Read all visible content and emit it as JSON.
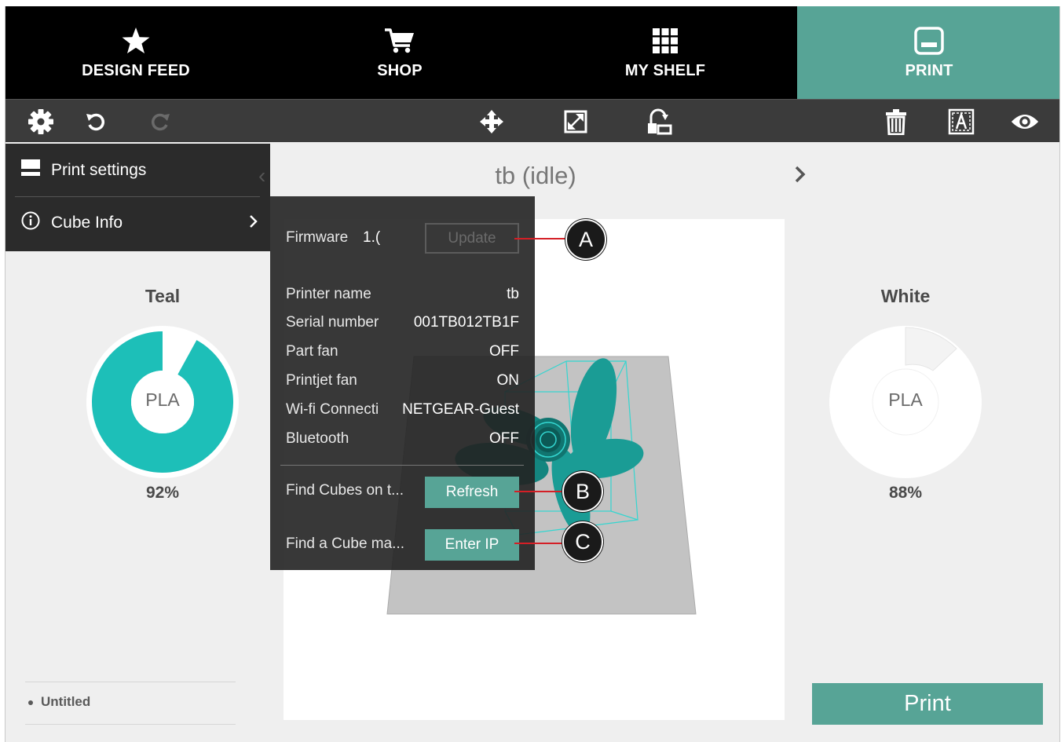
{
  "nav": {
    "tabs": [
      {
        "label": "DESIGN FEED",
        "icon": "star-icon"
      },
      {
        "label": "SHOP",
        "icon": "cart-icon"
      },
      {
        "label": "MY SHELF",
        "icon": "grid-icon"
      },
      {
        "label": "PRINT",
        "icon": "printer-icon",
        "active": true
      }
    ]
  },
  "toolbar": {
    "icons": [
      "gear-icon",
      "undo-icon",
      "redo-icon",
      "move-icon",
      "scale-icon",
      "rotate-icon",
      "trash-icon",
      "text-icon",
      "eye-icon"
    ]
  },
  "left_panel": {
    "items": [
      {
        "label": "Print settings",
        "icon": "print-settings-icon"
      },
      {
        "label": "Cube Info",
        "icon": "info-icon"
      }
    ]
  },
  "main": {
    "title": "tb (idle)"
  },
  "materials": {
    "left": {
      "name": "Teal",
      "type": "PLA",
      "percent_label": "92%",
      "fraction": 0.92,
      "color": "#1dbfb8"
    },
    "right": {
      "name": "White",
      "type": "PLA",
      "percent_label": "88%",
      "fraction": 0.88,
      "color": "#ffffff"
    }
  },
  "popup": {
    "firmware_label": "Firmware",
    "firmware_value": "1.(",
    "update_label": "Update",
    "rows": [
      {
        "label": "Printer name",
        "value": "tb"
      },
      {
        "label": "Serial number",
        "value": "001TB012TB1F"
      },
      {
        "label": "Part fan",
        "value": "OFF"
      },
      {
        "label": "Printjet fan",
        "value": "ON"
      },
      {
        "label": "Wi-fi Connecti",
        "value": "NETGEAR-Guest"
      },
      {
        "label": "Bluetooth",
        "value": "OFF"
      }
    ],
    "find_cubes_label": "Find Cubes on t...",
    "refresh_label": "Refresh",
    "find_cube_ip_label": "Find a Cube ma...",
    "enter_ip_label": "Enter IP"
  },
  "callouts": [
    "A",
    "B",
    "C"
  ],
  "footer": {
    "untitled_label": "Untitled",
    "print_label": "Print"
  },
  "colors": {
    "accent": "#57a496",
    "teal_filament": "#1dbfb8",
    "callout_line": "#d41f26"
  }
}
